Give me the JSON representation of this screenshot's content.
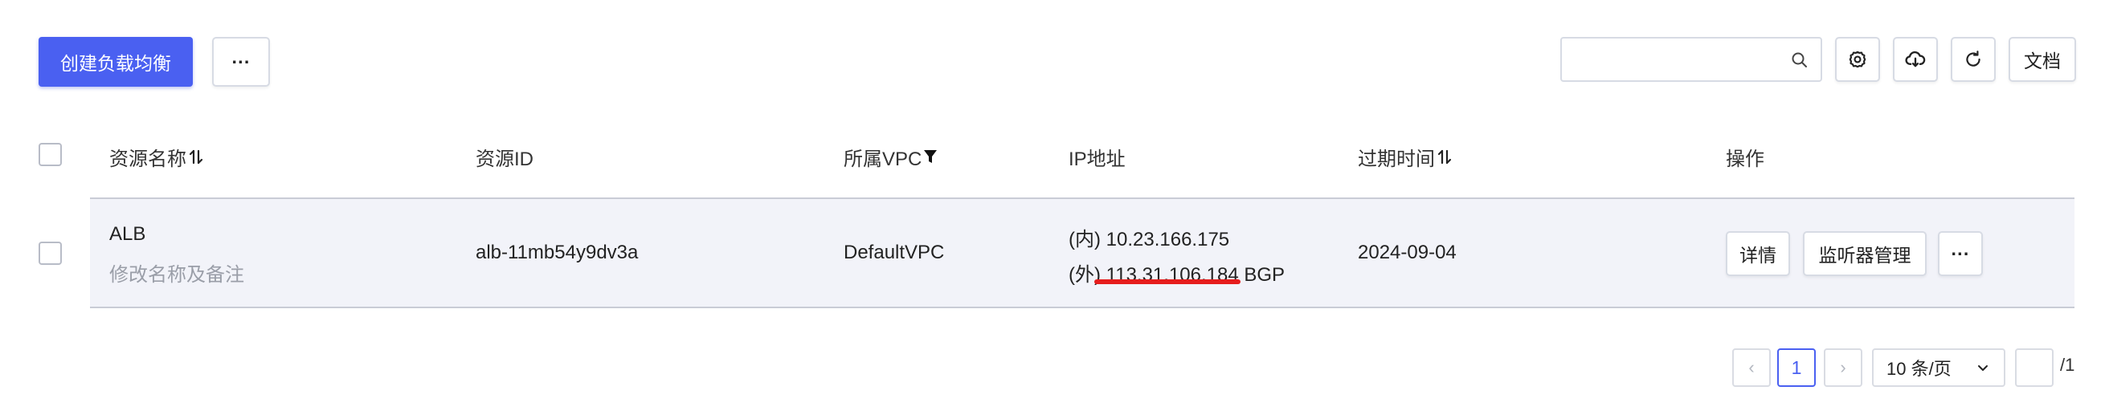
{
  "toolbar": {
    "create_label": "创建负载均衡",
    "more_label": "···",
    "search": {
      "value": "",
      "placeholder": ""
    },
    "docs_label": "文档"
  },
  "table": {
    "columns": {
      "name": "资源名称",
      "id": "资源ID",
      "vpc": "所属VPC",
      "ip": "IP地址",
      "expiry": "过期时间",
      "actions": "操作"
    },
    "rows": [
      {
        "name": "ALB",
        "name_edit": "修改名称及备注",
        "id": "alb-11mb54y9dv3a",
        "vpc": "DefaultVPC",
        "ip_inner_prefix": "(内)",
        "ip_inner": "10.23.166.175",
        "ip_outer_prefix": "(外)",
        "ip_outer": "113.31.106.184",
        "ip_outer_suffix": "BGP",
        "expiry": "2024-09-04",
        "actions": {
          "detail": "详情",
          "listener": "监听器管理",
          "more": "···"
        }
      }
    ]
  },
  "pagination": {
    "prev": "‹",
    "current_page": "1",
    "next": "›",
    "page_size": "10 条/页",
    "jump_value": "",
    "total_pages": "/1"
  },
  "colors": {
    "primary": "#4a60f1",
    "row_background": "#f2f3f9",
    "highlight_underline": "#e61d1d"
  }
}
